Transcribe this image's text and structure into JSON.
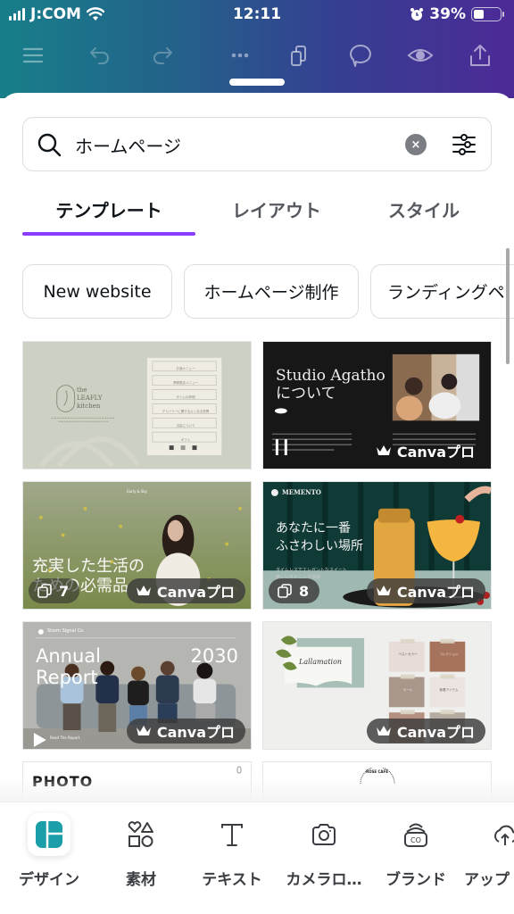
{
  "status_bar": {
    "carrier": "J:COM",
    "time": "12:11",
    "battery_percent": "39%",
    "battery_level": 0.39
  },
  "toolbar": {
    "icons": [
      "menu-icon",
      "undo-icon",
      "redo-icon",
      "more-icon",
      "pages-icon",
      "comment-icon",
      "preview-icon",
      "share-icon"
    ]
  },
  "search": {
    "value": "ホームページ",
    "clear_label": "×"
  },
  "tabs": [
    {
      "label": "テンプレート",
      "active": true
    },
    {
      "label": "レイアウト",
      "active": false
    },
    {
      "label": "スタイル",
      "active": false
    }
  ],
  "chips": [
    {
      "label": "New website"
    },
    {
      "label": "ホームページ制作"
    },
    {
      "label": "ランディングペ"
    }
  ],
  "templates": [
    {
      "name": "the LEAFLY kitchen",
      "title_line1": "the",
      "title_line2": "LEAFLY",
      "title_line3": "kitchen",
      "menu_items": [
        "お酒メニュー",
        "季節限定メニュー",
        "タイムの詳細",
        "デリバリーに関するよくある質問",
        "当店について",
        "ギフト"
      ],
      "pro": false
    },
    {
      "name": "Studio Agatho",
      "title_line1": "Studio Agatho",
      "title_line2": "について",
      "pro": true,
      "pro_label": "Canvaプロ"
    },
    {
      "name": "Early & Sky",
      "brand": "Early & Sky",
      "title_line1": "充実した生活の",
      "title_line2": "ための必需品",
      "pages": "7",
      "pro": true,
      "pro_label": "Canvaプロ"
    },
    {
      "name": "MEMENTO",
      "brand": "MEMENTO",
      "title_line1": "あなたに一番",
      "title_line2": "ふさわしい場所",
      "subtitle_line1": "タイムレスでエレガントなスイート",
      "subtitle_line2": "楽しいダイニング体験",
      "pages": "8",
      "pro": true,
      "pro_label": "Canvaプロ"
    },
    {
      "name": "Annual Report",
      "brand": "Storm Signal Co.",
      "title_line1": "Annual",
      "title_line2": "Report",
      "year": "2030",
      "link_text": "Read The Report",
      "pro": true,
      "pro_label": "Canvaプロ"
    },
    {
      "name": "Lallamation",
      "title_line1": "Lallamation",
      "swatches": [
        "ベストセラー",
        "コレクション",
        "セール",
        "新着アイテム",
        "",
        ""
      ],
      "pro": true,
      "pro_label": "Canvaプロ"
    },
    {
      "name": "PHOTO",
      "title_line1": "PHOTO",
      "pro": false
    },
    {
      "name": "Rose Cafe",
      "title_line1": "ROSE CAFE",
      "pro": false
    }
  ],
  "bottom_nav": [
    {
      "label": "デザイン",
      "icon": "design-icon",
      "active": true
    },
    {
      "label": "素材",
      "icon": "elements-icon",
      "active": false
    },
    {
      "label": "テキスト",
      "icon": "text-icon",
      "active": false
    },
    {
      "label": "カメラロ…",
      "icon": "camera-icon",
      "active": false
    },
    {
      "label": "ブランド",
      "icon": "brand-icon",
      "active": false
    },
    {
      "label": "アップ",
      "icon": "upload-icon",
      "active": false
    }
  ],
  "colors": {
    "accent": "#8b3dff",
    "header_start": "#177f8a",
    "header_end": "#4d2a96",
    "design_icon": "#1a9ea8"
  }
}
